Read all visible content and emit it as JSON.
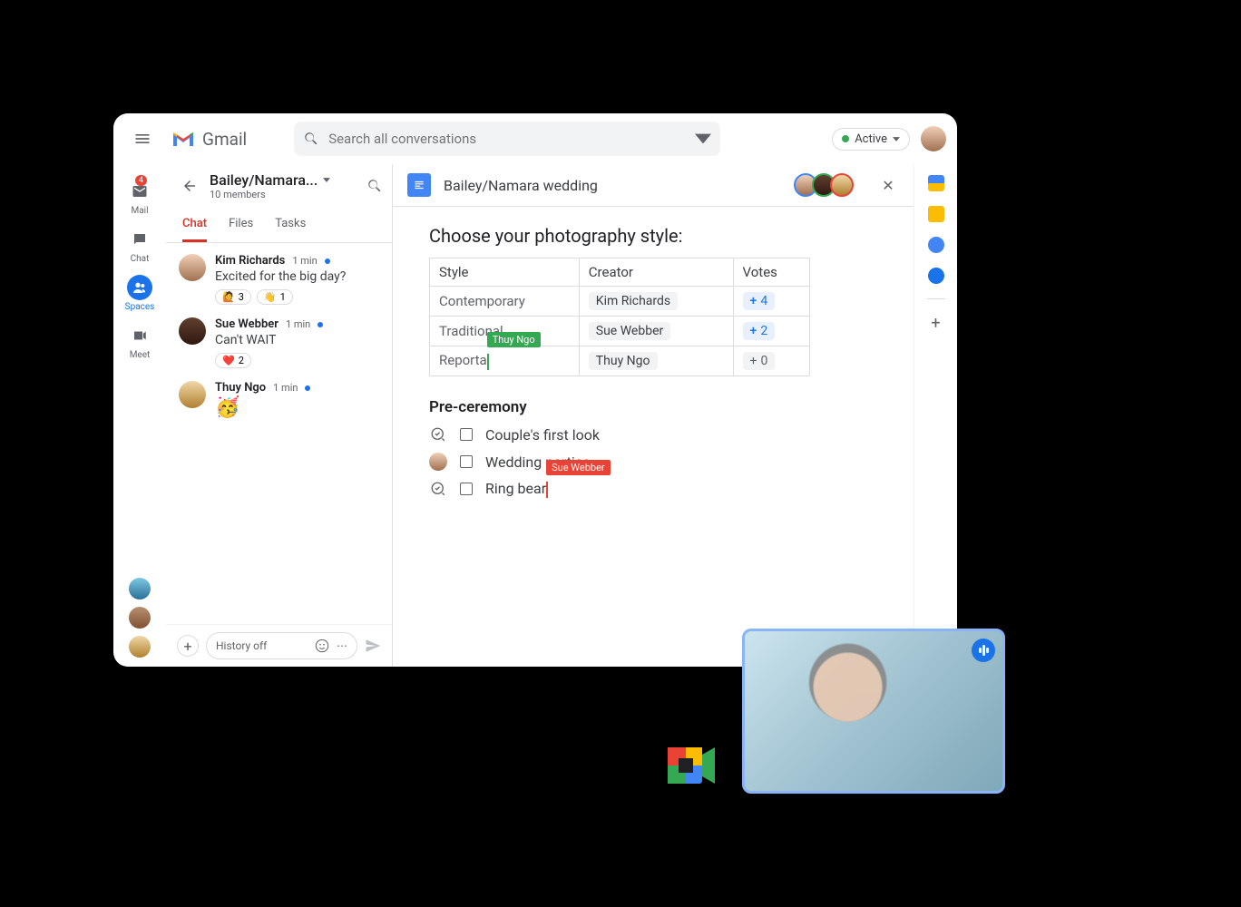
{
  "header": {
    "app_label": "Gmail",
    "search_placeholder": "Search all conversations",
    "status_label": "Active"
  },
  "rail": {
    "items": [
      {
        "label": "Mail",
        "badge": "4"
      },
      {
        "label": "Chat"
      },
      {
        "label": "Spaces"
      },
      {
        "label": "Meet"
      }
    ]
  },
  "space": {
    "title": "Bailey/Namara...",
    "subtitle": "10 members",
    "tabs": [
      "Chat",
      "Files",
      "Tasks"
    ],
    "messages": [
      {
        "name": "Kim Richards",
        "time": "1 min",
        "text": "Excited for the big day?",
        "reactions": [
          {
            "e": "🙋",
            "c": "3"
          },
          {
            "e": "👋",
            "c": "1"
          }
        ]
      },
      {
        "name": "Sue Webber",
        "time": "1 min",
        "text": "Can't WAIT",
        "reactions": [
          {
            "e": "❤️",
            "c": "2"
          }
        ]
      },
      {
        "name": "Thuy Ngo",
        "time": "1 min",
        "emoji": "🥳"
      }
    ],
    "composer_placeholder": "History off"
  },
  "doc": {
    "title": "Bailey/Namara wedding",
    "heading": "Choose your photography style:",
    "table": {
      "headers": [
        "Style",
        "Creator",
        "Votes"
      ],
      "rows": [
        {
          "style": "Contemporary",
          "creator": "Kim Richards",
          "votes": "4",
          "vote_class": "blue"
        },
        {
          "style": "Traditional",
          "creator": "Sue Webber",
          "votes": "2",
          "vote_class": "blue"
        },
        {
          "style": "Reporta",
          "creator": "Thuy Ngo",
          "votes": "0",
          "vote_class": "gray",
          "cursor": "Thuy Ngo"
        }
      ]
    },
    "section_title": "Pre-ceremony",
    "checklist": [
      {
        "label": "Couple's first look"
      },
      {
        "label": "Wedding parties"
      },
      {
        "label": "Ring bear",
        "cursor": "Sue Webber"
      }
    ]
  }
}
